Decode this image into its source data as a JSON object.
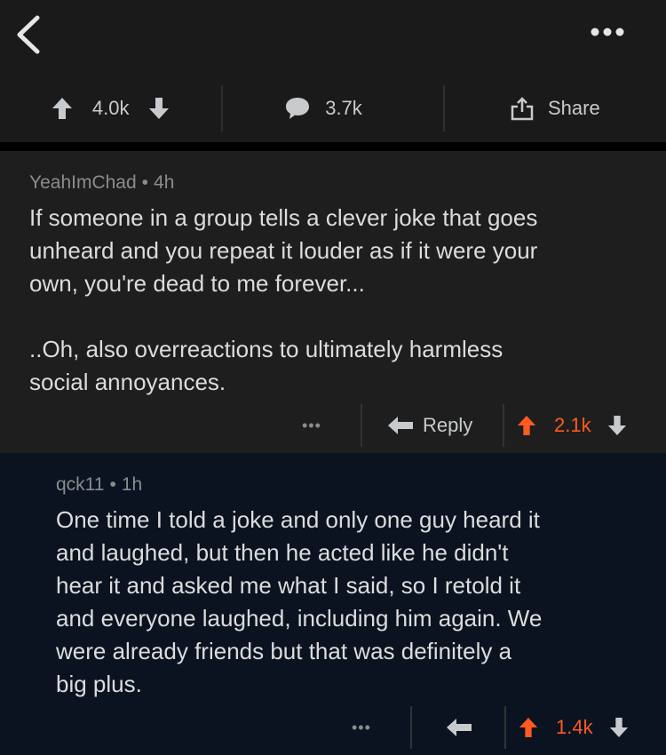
{
  "header": {
    "back_icon": "chevron-left-icon",
    "more_icon": "more-horizontal-icon",
    "upvotes": "4.0k",
    "comments": "3.7k",
    "share_label": "Share"
  },
  "comments": [
    {
      "author": "YeahImChad",
      "age": "4h",
      "text": "If someone in a group tells a clever joke that goes\nunheard and you repeat it louder as if it were your\nown, you're dead to me forever...\n\n..Oh, also overreactions to ultimately harmless\nsocial annoyances.",
      "more": "•••",
      "reply_label": "Reply",
      "score": "2.1k",
      "upvoted": true
    },
    {
      "author": "qck11",
      "age": "1h",
      "text": "One time I told a joke and only one guy heard it\nand laughed, but then he acted like he didn't\nhear it and asked me what I said, so I retold it\nand everyone laughed, including him again. We\nwere already friends but that was definitely a\nbig plus.",
      "more": "•••",
      "score": "1.4k",
      "upvoted": true
    }
  ],
  "colors": {
    "upvote": "#ff5a1f",
    "icon": "#c8cbcd",
    "reply_bg": "#0b1321"
  }
}
